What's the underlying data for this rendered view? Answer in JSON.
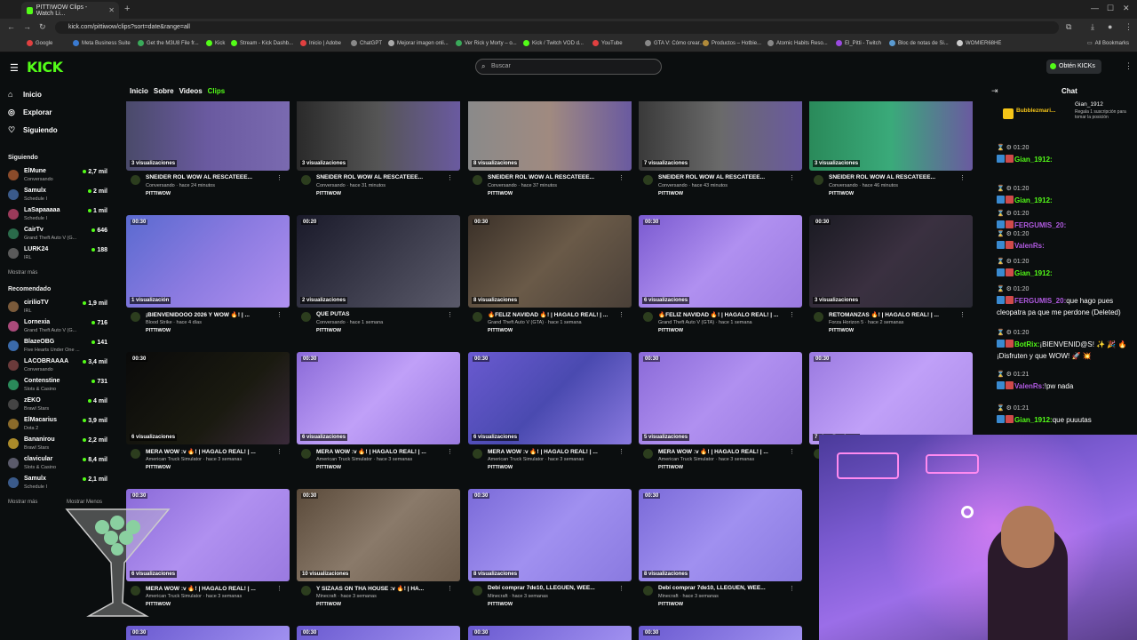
{
  "browser": {
    "tab_title": "PITTIWOW Clips - Watch Li...",
    "url": "kick.com/pittiwow/clips?sort=date&range=all",
    "bookmarks": [
      "Google",
      "Meta Business Suite",
      "Get the M3U8 File fr...",
      "Kick",
      "Stream - Kick Dashb...",
      "Inicio | Adobe",
      "ChatGPT",
      "Mejorar imagen onli...",
      "Ver Rick y Morty – o...",
      "Kick / Twitch VOD d...",
      "YouTube",
      "GTA V: Cómo crear...",
      "Productos – Hotbie...",
      "Atomic Habits Reso...",
      "El_Pitti - Twitch",
      "Bloc de notas de Si...",
      "WOMIER68HE"
    ],
    "all_bookmarks": "All Bookmarks"
  },
  "header": {
    "logo": "KICK",
    "search_placeholder": "Buscar",
    "obtain_label": "Obtén KICKs"
  },
  "sidebar": {
    "nav": [
      {
        "label": "Inicio",
        "icon": "home-icon"
      },
      {
        "label": "Explorar",
        "icon": "compass-icon"
      },
      {
        "label": "Siguiendo",
        "icon": "heart-icon"
      }
    ],
    "following_title": "Siguiendo",
    "following": [
      {
        "name": "ElMune",
        "category": "Conversando",
        "viewers": "2,7 mil",
        "color": "#8a4b2a"
      },
      {
        "name": "Samulx",
        "category": "Schedule I",
        "viewers": "2 mil",
        "color": "#3a5a8a"
      },
      {
        "name": "LaSapaaaaa",
        "category": "Schedule I",
        "viewers": "1 mil",
        "color": "#9a3a5a"
      },
      {
        "name": "CairTv",
        "category": "Grand Theft Auto V (G...",
        "viewers": "646",
        "color": "#2a6a4a"
      },
      {
        "name": "LURK24",
        "category": "IRL",
        "viewers": "188",
        "color": "#5a5a5a"
      }
    ],
    "more_following": "Mostrar más",
    "recommended_title": "Recomendado",
    "recommended": [
      {
        "name": "cirilioTV",
        "category": "IRL",
        "viewers": "1,9 mil",
        "color": "#7a5a3a"
      },
      {
        "name": "Lornexia",
        "category": "Grand Theft Auto V (G...",
        "viewers": "716",
        "color": "#aa4a7a"
      },
      {
        "name": "BlazeOBG",
        "category": "Five Hearts Under One ...",
        "viewers": "141",
        "color": "#3a6aaa"
      },
      {
        "name": "LACOBRAAAA",
        "category": "Conversando",
        "viewers": "3,4 mil",
        "color": "#6a3a3a"
      },
      {
        "name": "Contenstine",
        "category": "Slots & Casino",
        "viewers": "731",
        "color": "#2a8a5a"
      },
      {
        "name": "zEKO",
        "category": "Brawl Stars",
        "viewers": "4 mil",
        "color": "#444444"
      },
      {
        "name": "ElMacarius",
        "category": "Dota 2",
        "viewers": "3,9 mil",
        "color": "#8a6a2a"
      },
      {
        "name": "Bananirou",
        "category": "Brawl Stars",
        "viewers": "2,2 mil",
        "color": "#aa8a2a"
      },
      {
        "name": "clavicular",
        "category": "Slots & Casino",
        "viewers": "8,4 mil",
        "color": "#5a5a6a"
      },
      {
        "name": "Samulx",
        "category": "Schedule I",
        "viewers": "2,1 mil",
        "color": "#3a5a8a"
      }
    ],
    "more_recommended": "Mostrar más",
    "less_recommended": "Mostrar Menos"
  },
  "content_tabs": [
    {
      "label": "Inicio",
      "active": false
    },
    {
      "label": "Sobre",
      "active": false
    },
    {
      "label": "Videos",
      "active": false
    },
    {
      "label": "Clips",
      "active": true
    }
  ],
  "clips": [
    {
      "duration": "",
      "views": "3 visualizaciones",
      "title": "SNEIDER ROL WOW AL RESCATEEE...",
      "meta": "Conversando · hace 24 minutos",
      "channel": "PITTIWOW",
      "bg": "linear-gradient(90deg,#4a4a6a 0%,#6a5aa0 50%,#7a6ab0 100%)"
    },
    {
      "duration": "",
      "views": "3 visualizaciones",
      "title": "SNEIDER ROL WOW AL RESCATEEE...",
      "meta": "Conversando · hace 31 minutos",
      "channel": "PITTIWOW",
      "bg": "linear-gradient(90deg,#2a2a2a 0%,#555 50%,#6a5aa0 100%)"
    },
    {
      "duration": "",
      "views": "8 visualizaciones",
      "title": "SNEIDER ROL WOW AL RESCATEEE...",
      "meta": "Conversando · hace 37 minutos",
      "channel": "PITTIWOW",
      "bg": "linear-gradient(90deg,#8a8a8a 0%,#a08a80 50%,#6a5aa0 100%)"
    },
    {
      "duration": "",
      "views": "7 visualizaciones",
      "title": "SNEIDER ROL WOW AL RESCATEEE...",
      "meta": "Conversando · hace 43 minutos",
      "channel": "PITTIWOW",
      "bg": "linear-gradient(90deg,#3a3a3a 0%,#6a6a6a 50%,#6a5aa0 100%)"
    },
    {
      "duration": "",
      "views": "3 visualizaciones",
      "title": "SNEIDER ROL WOW AL RESCATEEE...",
      "meta": "Conversando · hace 46 minutos",
      "channel": "PITTIWOW",
      "bg": "linear-gradient(90deg,#2a8a5a 0%,#3aaa7a 50%,#6a5aa0 100%)"
    },
    {
      "duration": "00:30",
      "views": "1 visualización",
      "title": "¡BIENVENIDOOO 2026 Y WOW 🔥! | ...",
      "meta": "Blood Strike · hace 4 días",
      "channel": "PITTIWOW",
      "bg": "linear-gradient(135deg,#5a6ad0 0%,#8a7ae0 50%,#b090f0 100%)"
    },
    {
      "duration": "00:20",
      "views": "2 visualizaciones",
      "title": "QUE PUTAS",
      "meta": "Conversando · hace 1 semana",
      "channel": "PITTIWOW",
      "bg": "linear-gradient(135deg,#1a1a2a 0%,#3a3a4a 50%,#5a5a6a 100%)"
    },
    {
      "duration": "00:30",
      "views": "8 visualizaciones",
      "title": "🔥FELIZ NAVIDAD 🔥! | HAGALO REAL! | ...",
      "meta": "Grand Theft Auto V (GTA) · hace 1 semana",
      "channel": "PITTIWOW",
      "bg": "linear-gradient(135deg,#3a3028 0%,#6a5a48 50%,#4a4038 100%)"
    },
    {
      "duration": "00:30",
      "views": "6 visualizaciones",
      "title": "🔥FELIZ NAVIDAD 🔥! | HAGALO REAL! | ...",
      "meta": "Grand Theft Auto V (GTA) · hace 1 semana",
      "channel": "PITTIWOW",
      "bg": "linear-gradient(135deg,#7a5ad0 0%,#b090f0 50%,#9a7ae0 100%)"
    },
    {
      "duration": "00:30",
      "views": "3 visualizaciones",
      "title": "RETOMANZAS 🔥! | HAGALO REAL! | ...",
      "meta": "Forza Horizon 5 · hace 2 semanas",
      "channel": "PITTIWOW",
      "bg": "linear-gradient(135deg,#1a1a22 0%,#3a3040 50%,#2a2a34 100%)"
    },
    {
      "duration": "00:30",
      "views": "6 visualizaciones",
      "title": "MERA WOW :v 🔥! | HAGALO REAL! | ...",
      "meta": "American Truck Simulator · hace 3 semanas",
      "channel": "PITTIWOW",
      "bg": "linear-gradient(135deg,#0a0a0a 0%,#1a1a10 60%,#3a2a3a 100%)"
    },
    {
      "duration": "00:30",
      "views": "6 visualizaciones",
      "title": "MERA WOW :v 🔥! | HAGALO REAL! | ...",
      "meta": "American Truck Simulator · hace 3 semanas",
      "channel": "PITTIWOW",
      "bg": "linear-gradient(135deg,#8a6ad8 0%,#c0a0f8 50%,#9a7ae0 100%)"
    },
    {
      "duration": "00:30",
      "views": "6 visualizaciones",
      "title": "MERA WOW :v 🔥! | HAGALO REAL! | ...",
      "meta": "American Truck Simulator · hace 3 semanas",
      "channel": "PITTIWOW",
      "bg": "linear-gradient(135deg,#6a5ad0 0%,#4a4ab0 50%,#8a7ae0 100%)"
    },
    {
      "duration": "00:30",
      "views": "5 visualizaciones",
      "title": "MERA WOW :v 🔥! | HAGALO REAL! | ...",
      "meta": "American Truck Simulator · hace 3 semanas",
      "channel": "PITTIWOW",
      "bg": "linear-gradient(135deg,#8a6ad8 0%,#b090f0 50%,#9a7ae0 100%)"
    },
    {
      "duration": "00:30",
      "views": "7 visualizaciones",
      "title": "MERA WOW :v 🔥! | HAGALO REAL! | ...",
      "meta": "American Truck Simulator · hace 3 semanas",
      "channel": "PITTIWOW",
      "bg": "linear-gradient(135deg,#9a7ae0 0%,#c0a0f8 50%,#aa8ae8 100%)"
    },
    {
      "duration": "00:30",
      "views": "6 visualizaciones",
      "title": "MERA WOW :v 🔥! | HAGALO REAL! | ...",
      "meta": "American Truck Simulator · hace 3 semanas",
      "channel": "PITTIWOW",
      "bg": "linear-gradient(135deg,#8a6ad8 0%,#b090f0 50%,#9a7ae0 100%)"
    },
    {
      "duration": "00:30",
      "views": "10 visualizaciones",
      "title": "Y SIZAAS ON THA HOUSE :v 🔥! | HA...",
      "meta": "Minecraft · hace 3 semanas",
      "channel": "PITTIWOW",
      "bg": "linear-gradient(135deg,#5a4a3a 0%,#8a7a6a 50%,#6a5a4a 100%)"
    },
    {
      "duration": "00:30",
      "views": "8 visualizaciones",
      "title": "Debí comprar 7de10, LLEGUEN, WEE...",
      "meta": "Minecraft · hace 3 semanas",
      "channel": "PITTIWOW",
      "bg": "linear-gradient(135deg,#7a6ad8 0%,#a090f0 50%,#8a7ae0 100%)"
    },
    {
      "duration": "00:30",
      "views": "8 visualizaciones",
      "title": "Debí comprar 7de10, LLEGUEN, WEE...",
      "meta": "Minecraft · hace 3 semanas",
      "channel": "PITTIWOW",
      "bg": "linear-gradient(135deg,#7a6ad8 0%,#a090f0 50%,#8a7ae0 100%)"
    }
  ],
  "bottom_durations": [
    "00:30",
    "00:30",
    "00:30",
    "00:30"
  ],
  "chat": {
    "title": "Chat",
    "pinned_user": "Gian_1912",
    "pinned_text": "Regala 1 suscripción para tomar la posición",
    "pinned_name2": "Bubblezmari...",
    "messages": [
      {
        "time": "01:20",
        "user": "Gian_1912:",
        "text": "",
        "color": "#53fc18"
      },
      {
        "time": "01:20",
        "user": "Gian_1912:",
        "text": "",
        "color": "#53fc18"
      },
      {
        "time": "01:20",
        "user": "FERGUMIS_20:",
        "text": "",
        "color": "#b05ae0"
      },
      {
        "time": "01:20",
        "user": "ValenRs:",
        "text": "",
        "color": "#b05ae0"
      },
      {
        "time": "01:20",
        "user": "Gian_1912:",
        "text": "",
        "color": "#53fc18"
      },
      {
        "time": "01:20",
        "user": "FERGUMIS_20:",
        "text": "que hago pues cleopatra pa que me perdone (Deleted)",
        "color": "#b05ae0"
      },
      {
        "time": "01:20",
        "user": "BotRix:",
        "text": "¡BIENVENID@S! ✨ 🎉 🔥 ¡Disfruten y que WOW! 🚀 💥",
        "color": "#53fc18"
      },
      {
        "time": "01:21",
        "user": "ValenRs:",
        "text": "!pw nada",
        "color": "#b05ae0"
      },
      {
        "time": "01:21",
        "user": "Gian_1912:",
        "text": "que puuutas",
        "color": "#53fc18"
      }
    ]
  }
}
